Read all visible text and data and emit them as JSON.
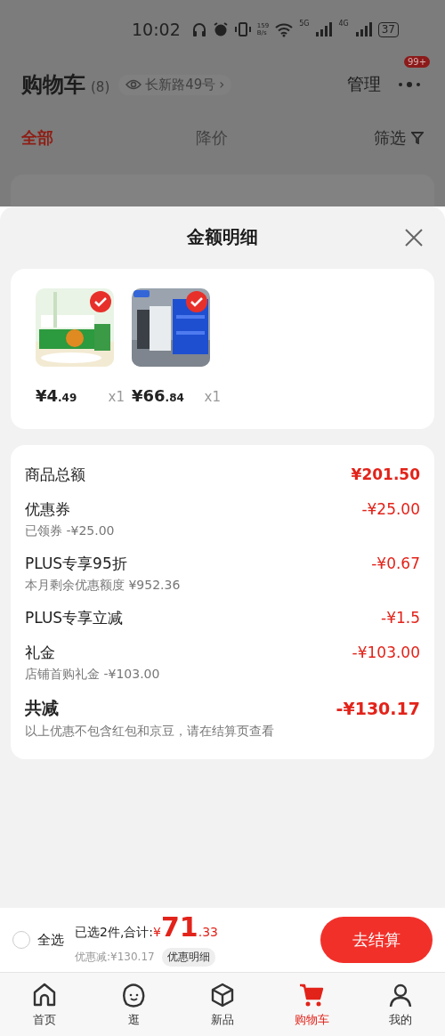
{
  "status_bar": {
    "time": "10:02",
    "speed_value": "159",
    "speed_unit": "B/s",
    "net_a": "5G",
    "net_b": "4G",
    "battery": "37"
  },
  "header": {
    "title": "购物车",
    "count": "(8)",
    "location": "长新路49号",
    "chevron": "›",
    "manage": "管理",
    "badge": "99+"
  },
  "tabs": [
    {
      "label": "全部",
      "selected": true
    },
    {
      "label": "降价",
      "selected": false
    }
  ],
  "filter": "筛选",
  "sheet": {
    "title": "金额明细",
    "products": [
      {
        "kind": "picture",
        "currency": "¥",
        "price_main": "4",
        "price_cents": ".49",
        "qty": "x1",
        "selected": true
      },
      {
        "kind": "picture",
        "currency": "¥",
        "price_main": "66",
        "price_cents": ".84",
        "qty": "x1",
        "selected": true
      }
    ],
    "lines": [
      {
        "kind": "subtotal",
        "label": "商品总额",
        "amount": "¥201.50"
      },
      {
        "kind": "discount",
        "label": "优惠券",
        "amount": "-¥25.00",
        "note": "已领券 -¥25.00"
      },
      {
        "kind": "discount",
        "label": "PLUS专享95折",
        "amount": "-¥0.67",
        "note": "本月剩余优惠额度 ¥952.36"
      },
      {
        "kind": "discount",
        "label": "PLUS专享立减",
        "amount": "-¥1.5"
      },
      {
        "kind": "discount",
        "label": "礼金",
        "amount": "-¥103.00",
        "note": "店铺首购礼金 -¥103.00"
      },
      {
        "kind": "total",
        "label": "共减",
        "amount": "-¥130.17",
        "note": "以上优惠不包含红包和京豆，请在结算页查看"
      }
    ]
  },
  "checkout": {
    "select_all": "全选",
    "checked": false,
    "summary": "已选2件,合计:",
    "currency": "¥",
    "price_main": "71",
    "price_cents": ".33",
    "discount": "优惠减:¥130.17",
    "detail_button": "优惠明细",
    "checkout_button": "去结算"
  },
  "nav": [
    {
      "kind": "home",
      "label": "首页",
      "selected": false
    },
    {
      "kind": "face",
      "label": "逛",
      "selected": false
    },
    {
      "kind": "box",
      "label": "新品",
      "selected": false
    },
    {
      "kind": "cart",
      "label": "购物车",
      "selected": true
    },
    {
      "kind": "person",
      "label": "我的",
      "selected": false
    }
  ]
}
